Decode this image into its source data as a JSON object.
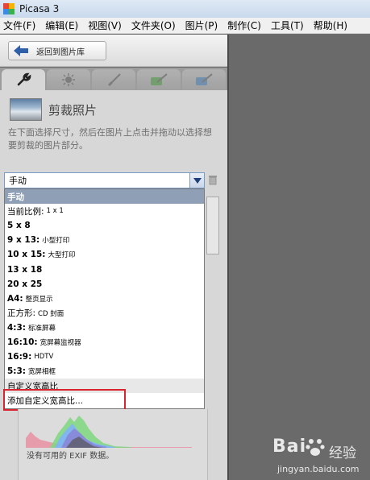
{
  "window": {
    "title": "Picasa 3"
  },
  "menu": [
    "文件(F)",
    "编辑(E)",
    "视图(V)",
    "文件夹(O)",
    "图片(P)",
    "制作(C)",
    "工具(T)",
    "帮助(H)"
  ],
  "toolbar": {
    "back_label": "返回到图片库"
  },
  "panel": {
    "title": "剪裁照片",
    "description": "在下面选择尺寸，然后在图片上点击并拖动以选择想要剪裁的图片部分。",
    "select_value": "手动",
    "options": [
      {
        "main": "手动",
        "sub": "",
        "selected": true
      },
      {
        "main": "当前比例:",
        "sub": "1 x 1",
        "plain": true
      },
      {
        "main": "5 x 8",
        "sub": ""
      },
      {
        "main": "9 x 13:",
        "sub": "小型打印"
      },
      {
        "main": "10 x 15:",
        "sub": "大型打印"
      },
      {
        "main": "13 x 18",
        "sub": ""
      },
      {
        "main": "20 x 25",
        "sub": ""
      },
      {
        "main": "A4:",
        "sub": "整页显示"
      },
      {
        "main": "正方形:",
        "sub": "CD 封面",
        "plain": true
      },
      {
        "main": "4:3:",
        "sub": "标准屏幕"
      },
      {
        "main": "16:10:",
        "sub": "宽屏幕监视器"
      },
      {
        "main": "16:9:",
        "sub": "HDTV"
      },
      {
        "main": "5:3:",
        "sub": "宽屏相框"
      },
      {
        "main": "自定义宽高比",
        "sub": "",
        "plain": true,
        "group": true
      },
      {
        "main": "添加自定义宽高比...",
        "sub": "",
        "plain": true
      }
    ],
    "no_exif": "没有可用的 EXIF 数据。"
  },
  "icons": {
    "tabs": [
      "wrench-icon",
      "sun-icon",
      "brush-icon",
      "green-brush-icon",
      "blue-brush-icon"
    ],
    "back": "back-arrow-icon",
    "dropdown": "chevron-down-icon",
    "trash": "trash-icon"
  },
  "colors": {
    "selected_row": "#8f9fb5",
    "highlight": "#d9232e",
    "back_arrow": "#2e5fa8"
  },
  "watermark": {
    "logo": "Bai",
    "brand": "经验",
    "url": "jingyan.baidu.com"
  }
}
